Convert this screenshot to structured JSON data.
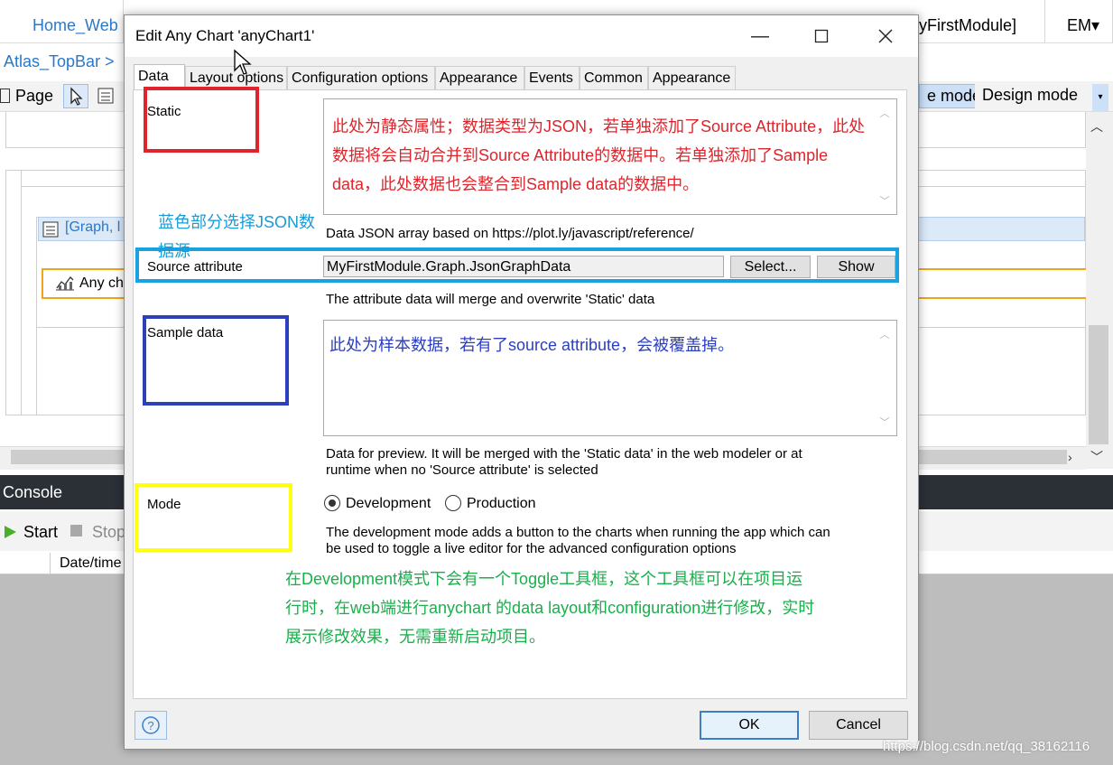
{
  "ide": {
    "tabs": [
      {
        "label": "Home_Web"
      },
      {
        "label": "yFirstModule]"
      },
      {
        "label": "EM▾"
      }
    ],
    "breadcrumb": "Atlas_TopBar >",
    "toolbar": {
      "page_label": "Page",
      "live_mode_label": "e mode",
      "design_mode_label": "Design mode"
    },
    "canvas": {
      "graph_row_label": "[Graph, l",
      "anychart_label": "Any ch"
    },
    "console": {
      "title": "Console",
      "start_label": "Start",
      "stop_label": "Stop",
      "datetime_col": "Date/time"
    }
  },
  "dialog": {
    "title": "Edit Any Chart 'anyChart1'",
    "tabs": [
      {
        "label": "Data",
        "active": true
      },
      {
        "label": "Layout options"
      },
      {
        "label": "Configuration options"
      },
      {
        "label": "Appearance"
      },
      {
        "label": "Events"
      },
      {
        "label": "Common"
      },
      {
        "label": "Appearance"
      }
    ],
    "static": {
      "label": "Static",
      "help": "Data JSON array based on https://plot.ly/javascript/reference/"
    },
    "source_attribute": {
      "label": "Source attribute",
      "value": "MyFirstModule.Graph.JsonGraphData",
      "select_label": "Select...",
      "show_label": "Show",
      "help": "The attribute data will merge and overwrite 'Static' data"
    },
    "sample_data": {
      "label": "Sample data",
      "help_line1": "Data for preview. It will be merged with the 'Static data' in the web modeler or at",
      "help_line2": "runtime when no 'Source attribute' is selected"
    },
    "mode": {
      "label": "Mode",
      "options": [
        {
          "label": "Development",
          "selected": true
        },
        {
          "label": "Production",
          "selected": false
        }
      ],
      "help_line1": "The development mode adds a button to the charts when running the app which can",
      "help_line2": "be used to toggle a live editor for the advanced configuration options"
    },
    "ok_label": "OK",
    "cancel_label": "Cancel"
  },
  "annotations": {
    "static_note": "此处为静态属性；数据类型为JSON，若单独添加了Source Attribute，此处数据将会自动合并到Source Attribute的数据中。若单独添加了Sample data，此处数据也会整合到Sample data的数据中。",
    "blue_note": "蓝色部分选择JSON数据源",
    "sample_note": "此处为样本数据，若有了source attribute，会被覆盖掉。",
    "mode_note": "在Development模式下会有一个Toggle工具框，这个工具框可以在项目运行时，在web端进行anychart 的data layout和configuration进行修改，实时展示修改效果，无需重新启动项目。"
  },
  "watermark": "https://blog.csdn.net/qq_38162116",
  "colors": {
    "annotation_red": "#e0242b",
    "annotation_blue": "#1aa1e0",
    "annotation_navy": "#2b3fbf",
    "annotation_yellow": "#ffff14",
    "annotation_green": "#19b04b",
    "accent_blue": "#2a78c8"
  }
}
